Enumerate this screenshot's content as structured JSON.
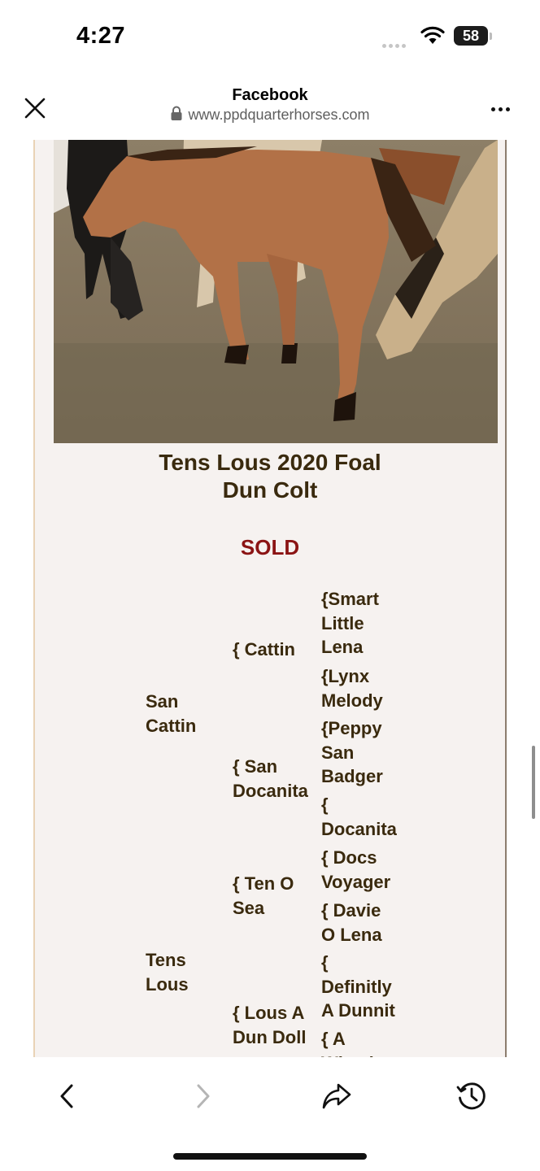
{
  "status_bar": {
    "time": "4:27",
    "battery": "58"
  },
  "browser": {
    "title": "Facebook",
    "url": "www.ppdquarterhorses.com"
  },
  "article": {
    "headline_line1": "Tens Lous 2020 Foal",
    "headline_line2": "Dun Colt",
    "status": "SOLD",
    "pedigree": {
      "col1": [
        "San\nCattin",
        "Tens\nLous"
      ],
      "col2": [
        "{ Cattin",
        "{ San\nDocanita",
        "{ Ten O\nSea",
        "{ Lous A\nDun Doll"
      ],
      "col3": [
        "{Smart\nLittle\nLena",
        "{Lynx\nMelody",
        "{Peppy\nSan\nBadger",
        "{\nDocanita",
        "{ Docs\nVoyager",
        "{ Davie\nO Lena",
        "{\nDefinitly\nA Dunnit",
        "{ A\nWheel"
      ]
    }
  },
  "icons": {
    "close": "close-icon",
    "lock": "lock-icon",
    "more": "more-icon",
    "back": "chevron-left-icon",
    "forward": "chevron-right-icon",
    "share": "share-icon",
    "history": "history-icon"
  }
}
